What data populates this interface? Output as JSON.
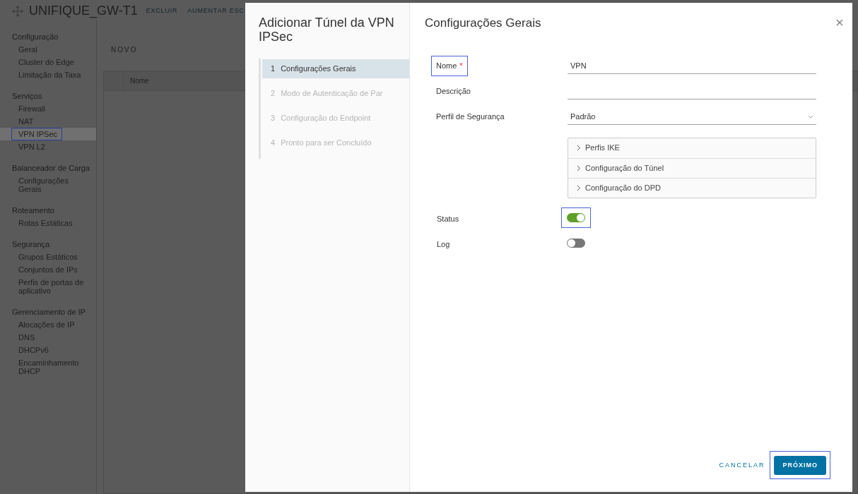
{
  "app": {
    "title": "UNIFIQUE_GW-T1",
    "actions": [
      "EXCLUIR",
      "AUMENTAR ESC"
    ]
  },
  "sidebar": {
    "sections": [
      {
        "title": "Configuração",
        "items": [
          {
            "label": "Geral",
            "selected": false,
            "highlighted": false
          },
          {
            "label": "Cluster do Edge",
            "selected": false,
            "highlighted": false
          },
          {
            "label": "Limitação da Taxa",
            "selected": false,
            "highlighted": false
          }
        ]
      },
      {
        "title": "Serviços",
        "items": [
          {
            "label": "Firewall",
            "selected": false,
            "highlighted": false
          },
          {
            "label": "NAT",
            "selected": false,
            "highlighted": false
          },
          {
            "label": "VPN IPSec",
            "selected": true,
            "highlighted": true
          },
          {
            "label": "VPN L2",
            "selected": false,
            "highlighted": false
          }
        ]
      },
      {
        "title": "Balanceador de Carga",
        "items": [
          {
            "label": "Configurações Gerais",
            "selected": false,
            "highlighted": false
          }
        ]
      },
      {
        "title": "Roteamento",
        "items": [
          {
            "label": "Rotas Estáticas",
            "selected": false,
            "highlighted": false
          }
        ]
      },
      {
        "title": "Segurança",
        "items": [
          {
            "label": "Grupos Estáticos",
            "selected": false,
            "highlighted": false
          },
          {
            "label": "Conjuntos de IPs",
            "selected": false,
            "highlighted": false
          },
          {
            "label": "Perfis de portas de aplicativo",
            "selected": false,
            "highlighted": false
          }
        ]
      },
      {
        "title": "Gerenciamento de IP",
        "items": [
          {
            "label": "Alocações de IP",
            "selected": false,
            "highlighted": false
          },
          {
            "label": "DNS",
            "selected": false,
            "highlighted": false
          },
          {
            "label": "DHCPv6",
            "selected": false,
            "highlighted": false
          },
          {
            "label": "Encaminhamento DHCP",
            "selected": false,
            "highlighted": false
          }
        ]
      }
    ]
  },
  "content": {
    "toolbar_button": "NOVO",
    "table": {
      "columns": [
        "Nome"
      ]
    }
  },
  "dialog": {
    "title": "Adicionar Túnel da VPN IPSec",
    "steps": [
      {
        "number": "1",
        "label": "Configurações Gerais",
        "selected": true
      },
      {
        "number": "2",
        "label": "Modo de Autenticação de Par",
        "selected": false
      },
      {
        "number": "3",
        "label": "Configuração do Endpoint",
        "selected": false
      },
      {
        "number": "4",
        "label": "Pronto para ser Concluído",
        "selected": false
      }
    ],
    "heading": "Configurações Gerais",
    "fields": [
      {
        "kind": "text",
        "label": "Nome",
        "required_mark": "*",
        "value": "VPN",
        "highlighted": true
      },
      {
        "kind": "text",
        "label": "Descrição",
        "highlighted": false
      },
      {
        "kind": "select",
        "label": "Perfil de Segurança",
        "value": "Padrão",
        "highlighted": false
      },
      {
        "kind": "accordion",
        "sections": [
          {
            "label": "Perfis IKE",
            "expanded": false
          },
          {
            "label": "Configuração do Túnel",
            "expanded": false
          },
          {
            "label": "Configuração do DPD",
            "expanded": false
          }
        ]
      },
      {
        "kind": "toggle",
        "label": "Status",
        "on": true,
        "highlighted": true
      },
      {
        "kind": "toggle",
        "label": "Log",
        "on": false,
        "highlighted": false
      }
    ],
    "buttons": [
      {
        "kind": "link",
        "label": "CANCELAR",
        "highlighted": false
      },
      {
        "kind": "primary",
        "label": "PRÓXIMO",
        "highlighted": true
      }
    ]
  }
}
